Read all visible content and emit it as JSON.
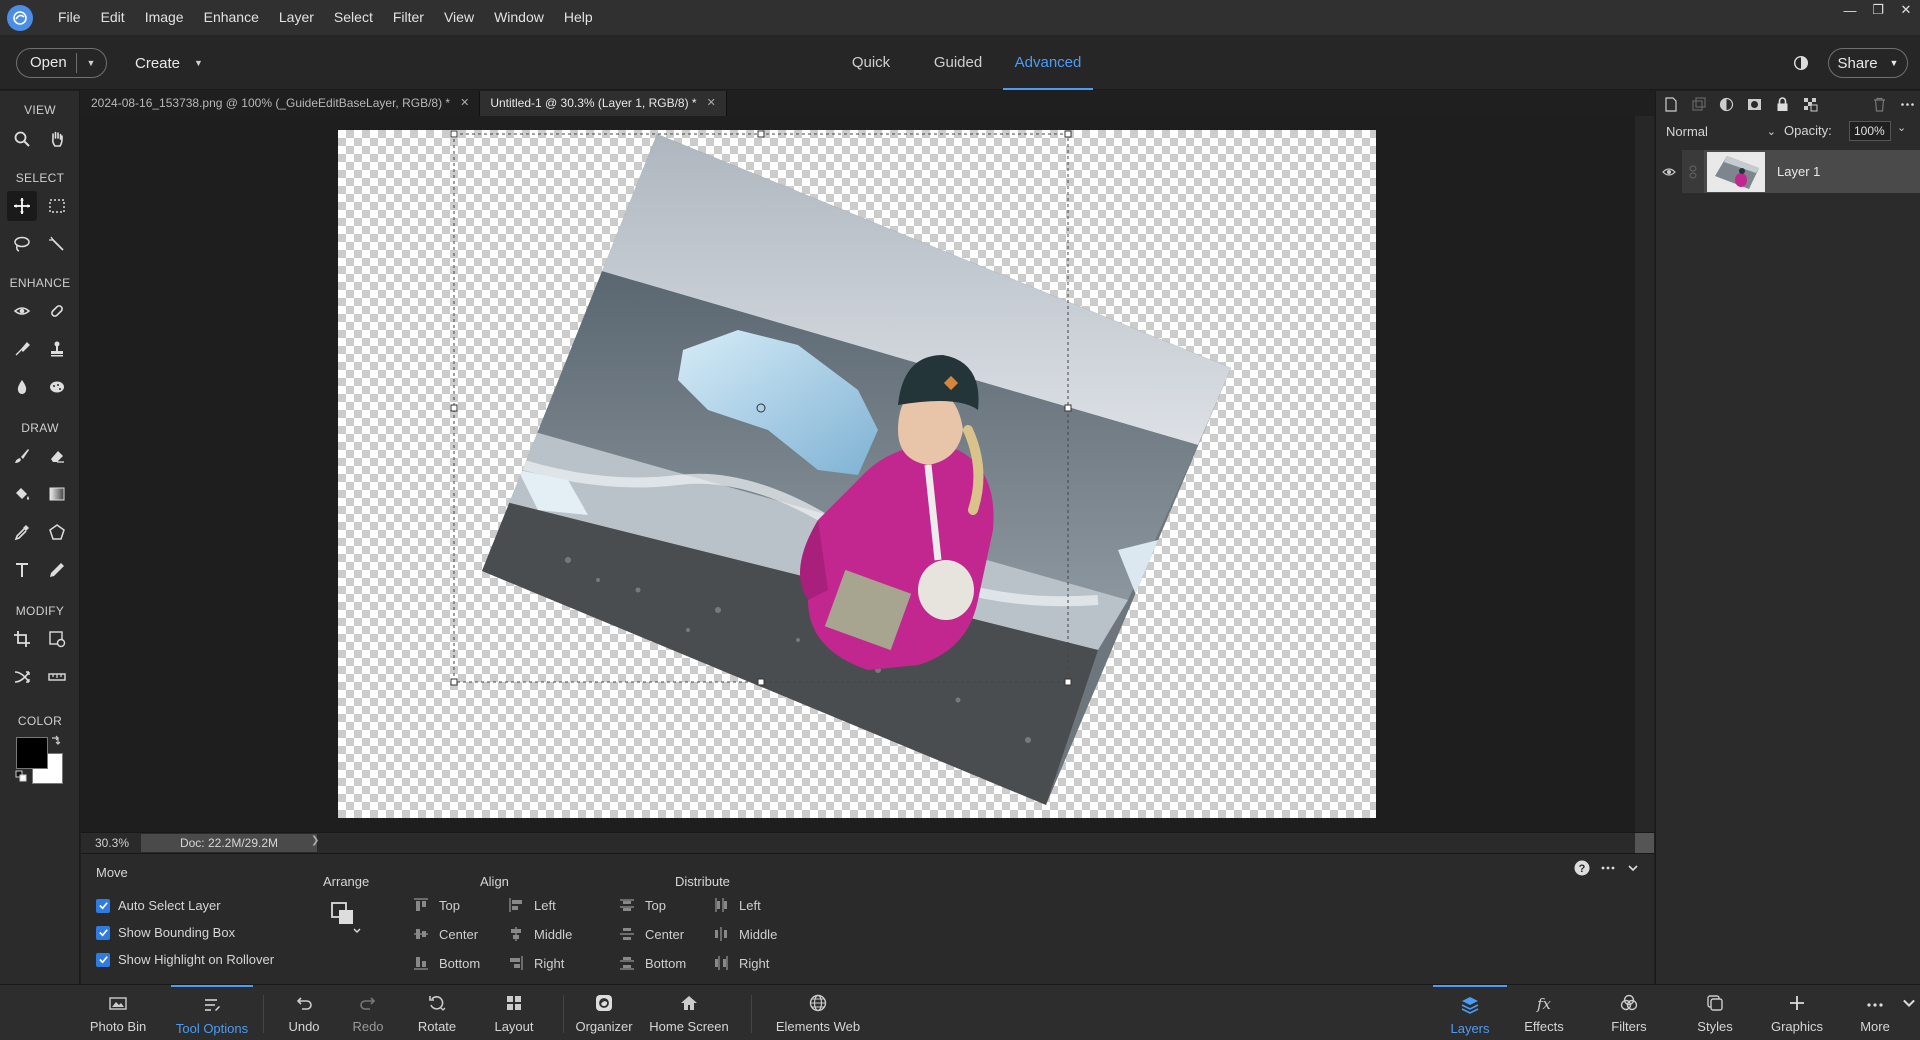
{
  "menubar": {
    "items": [
      "File",
      "Edit",
      "Image",
      "Enhance",
      "Layer",
      "Select",
      "Filter",
      "View",
      "Window",
      "Help"
    ]
  },
  "modebar": {
    "open_label": "Open",
    "create_label": "Create",
    "tabs": [
      {
        "label": "Quick",
        "active": false
      },
      {
        "label": "Guided",
        "active": false
      },
      {
        "label": "Advanced",
        "active": true
      }
    ],
    "share_label": "Share"
  },
  "toolbox": {
    "sections": {
      "view": "VIEW",
      "select": "SELECT",
      "enhance": "ENHANCE",
      "draw": "DRAW",
      "modify": "MODIFY",
      "color": "COLOR"
    },
    "foreground_color": "#000000",
    "background_color": "#ffffff"
  },
  "documents": {
    "tabs": [
      {
        "title": "2024-08-16_153738.png @ 100% (_GuideEditBaseLayer, RGB/8) *",
        "active": false
      },
      {
        "title": "Untitled-1 @ 30.3% (Layer 1, RGB/8) *",
        "active": true
      }
    ]
  },
  "status": {
    "zoom": "30.3%",
    "doc_size": "Doc: 22.2M/29.2M"
  },
  "tool_options": {
    "tool_name": "Move",
    "checkboxes": [
      {
        "label": "Auto Select Layer",
        "checked": true
      },
      {
        "label": "Show Bounding Box",
        "checked": true
      },
      {
        "label": "Show Highlight on Rollover",
        "checked": true
      }
    ],
    "arrange_title": "Arrange",
    "align_title": "Align",
    "align_vertical": [
      "Top",
      "Center",
      "Bottom"
    ],
    "align_horizontal": [
      "Left",
      "Middle",
      "Right"
    ],
    "distribute_title": "Distribute",
    "distribute_vertical": [
      "Top",
      "Center",
      "Bottom"
    ],
    "distribute_horizontal": [
      "Left",
      "Middle",
      "Right"
    ]
  },
  "taskbar": {
    "left": [
      {
        "label": "Photo Bin",
        "icon": "photo-bin-icon"
      },
      {
        "label": "Tool Options",
        "icon": "tool-options-icon",
        "active": true
      },
      {
        "label": "Undo",
        "icon": "undo-icon"
      },
      {
        "label": "Redo",
        "icon": "redo-icon"
      },
      {
        "label": "Rotate",
        "icon": "rotate-icon"
      },
      {
        "label": "Layout",
        "icon": "layout-icon"
      },
      {
        "label": "Organizer",
        "icon": "organizer-icon"
      },
      {
        "label": "Home Screen",
        "icon": "home-icon"
      },
      {
        "label": "Elements Web",
        "icon": "globe-icon"
      }
    ],
    "right": [
      {
        "label": "Layers",
        "icon": "layers-icon",
        "active": true
      },
      {
        "label": "Effects",
        "icon": "fx-icon"
      },
      {
        "label": "Filters",
        "icon": "filters-icon"
      },
      {
        "label": "Styles",
        "icon": "styles-icon"
      },
      {
        "label": "Graphics",
        "icon": "plus-icon"
      },
      {
        "label": "More",
        "icon": "more-icon"
      }
    ]
  },
  "layers_panel": {
    "blend_mode": "Normal",
    "opacity_label": "Opacity:",
    "opacity_value": "100%",
    "layers": [
      {
        "name": "Layer 1",
        "visible": true,
        "selected": true
      }
    ]
  },
  "colors": {
    "accent": "#4b9cf5",
    "checkbox": "#2f7be0",
    "jacket": "#c2278f"
  }
}
